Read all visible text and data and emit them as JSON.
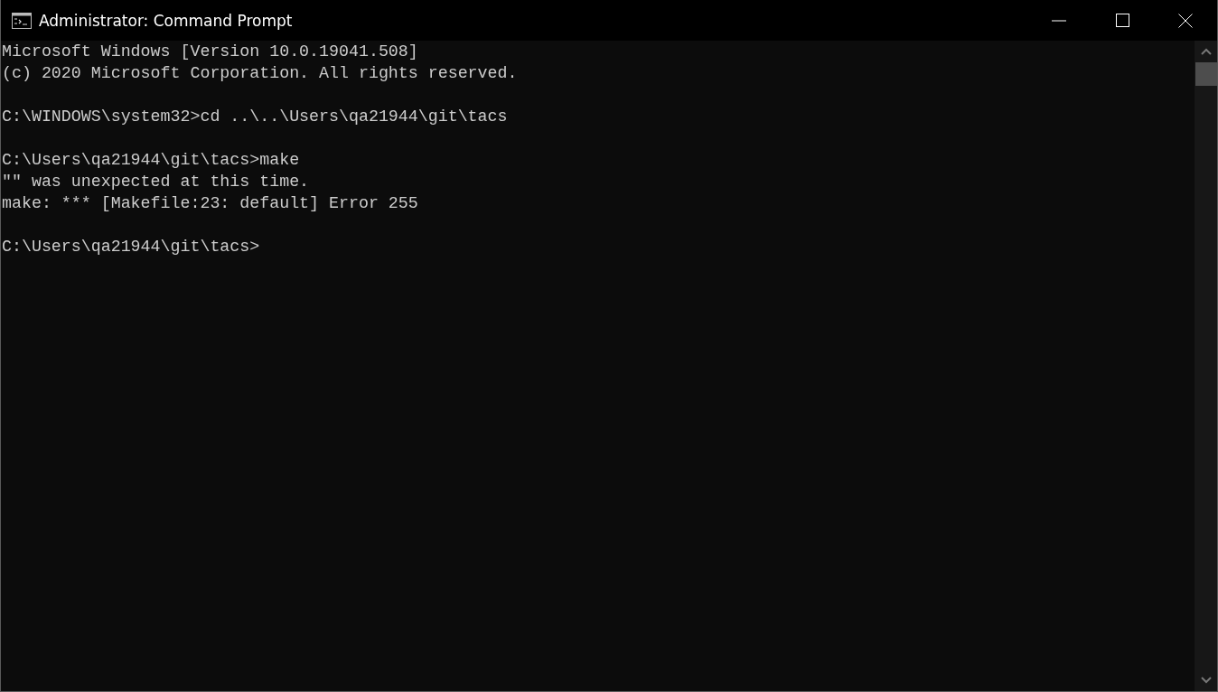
{
  "window": {
    "title": "Administrator: Command Prompt"
  },
  "console": {
    "blocks": [
      {
        "lines": [
          "Microsoft Windows [Version 10.0.19041.508]",
          "(c) 2020 Microsoft Corporation. All rights reserved."
        ]
      },
      {
        "lines": [
          "C:\\WINDOWS\\system32>cd ..\\..\\Users\\qa21944\\git\\tacs"
        ]
      },
      {
        "lines": [
          "C:\\Users\\qa21944\\git\\tacs>make",
          "\"\" was unexpected at this time.",
          "make: *** [Makefile:23: default] Error 255"
        ]
      },
      {
        "lines": [
          "C:\\Users\\qa21944\\git\\tacs>"
        ]
      }
    ]
  }
}
